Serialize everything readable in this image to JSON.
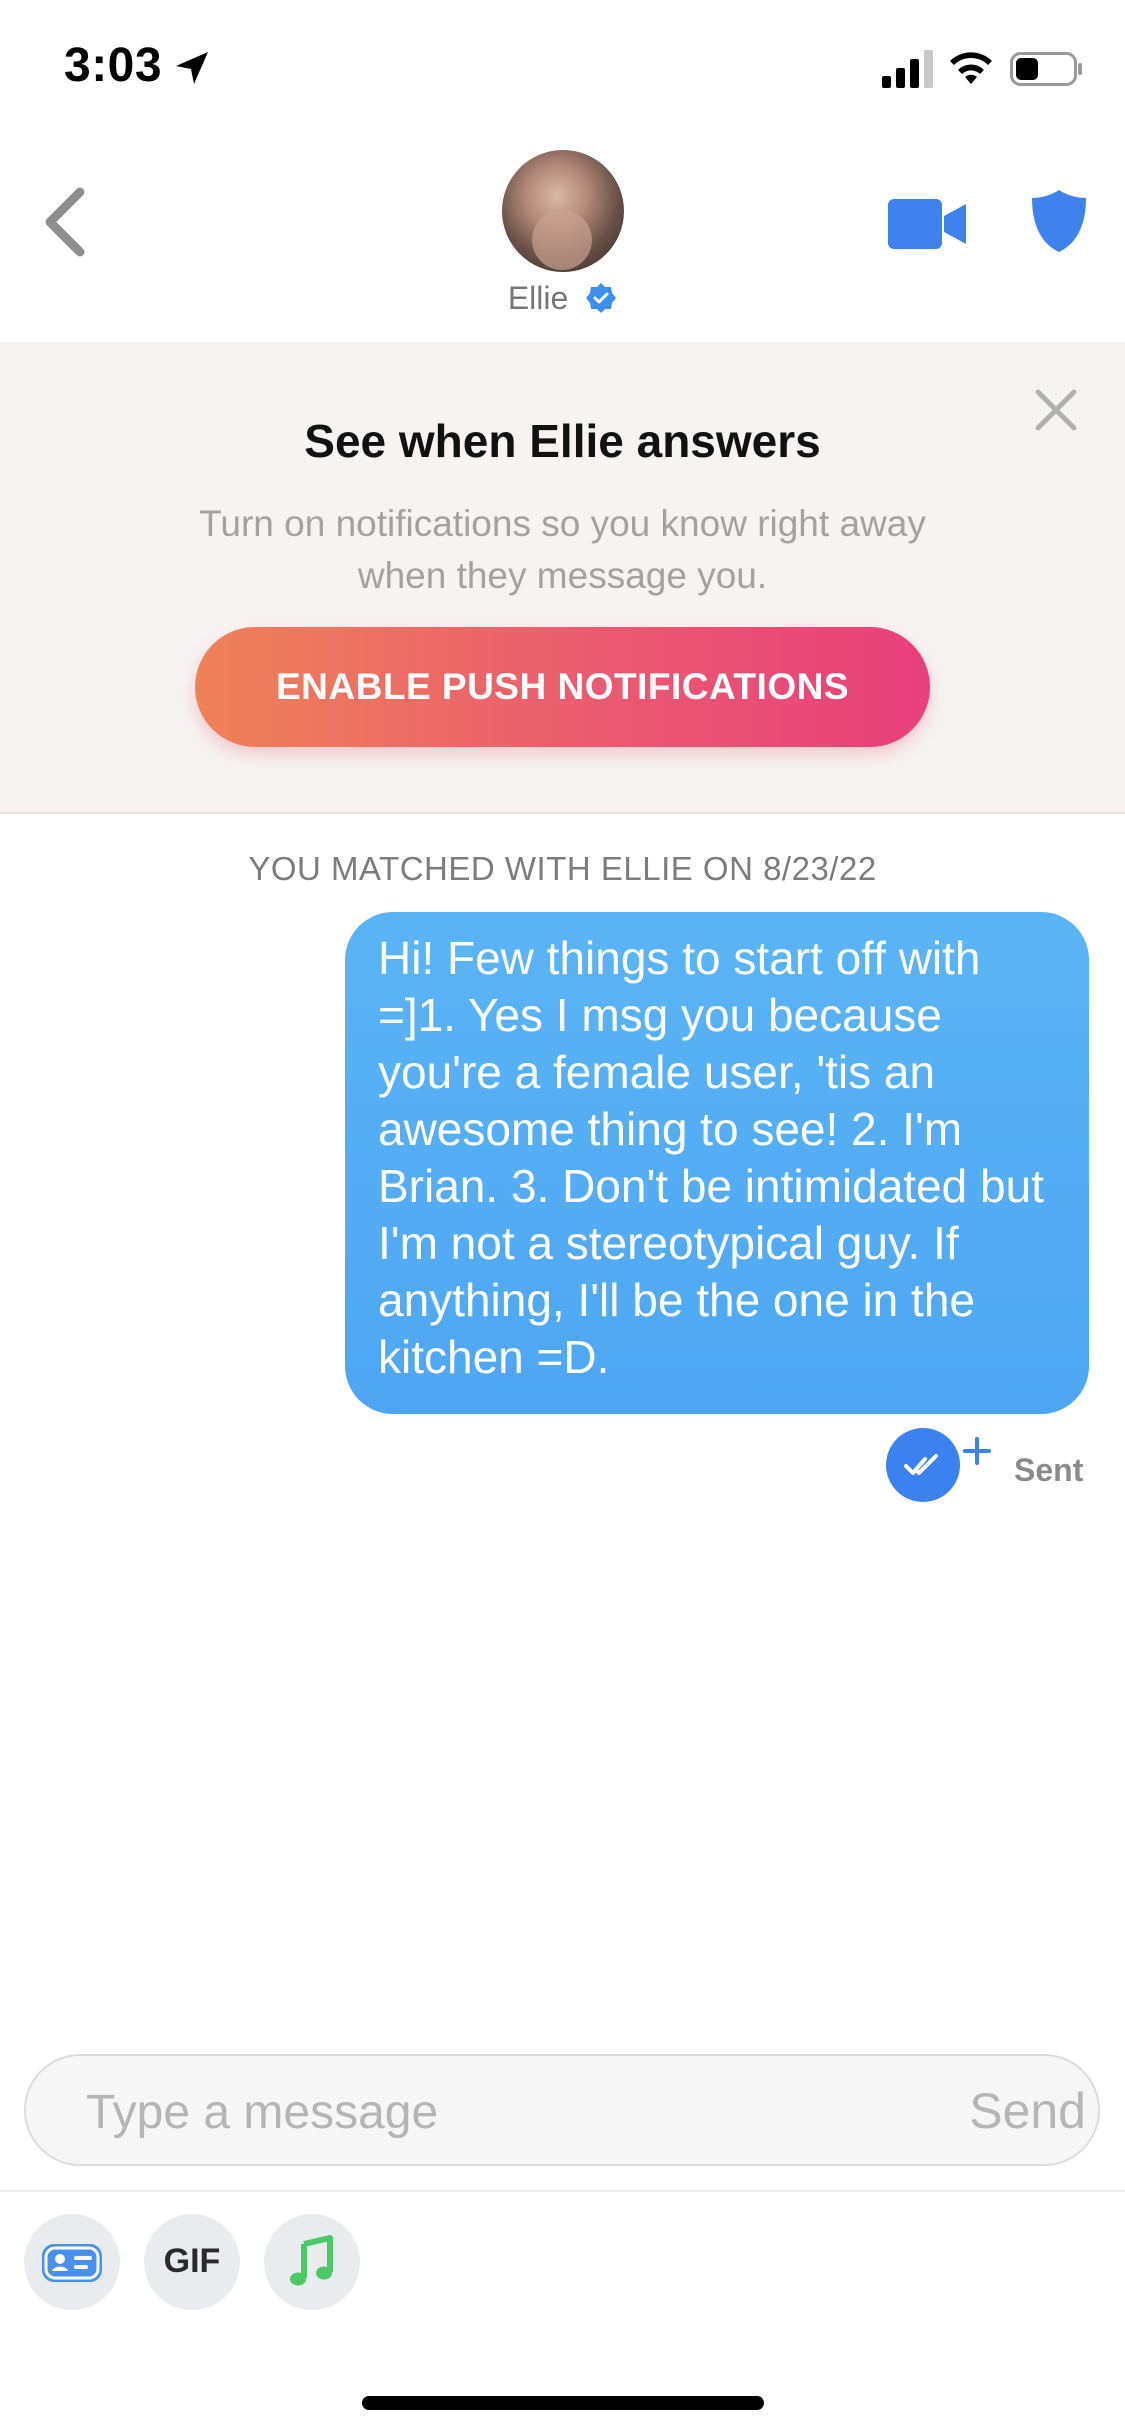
{
  "status_bar": {
    "time": "3:03"
  },
  "header": {
    "name": "Ellie"
  },
  "banner": {
    "title": "See when Ellie answers",
    "subtitle": "Turn on notifications so you know right away when they message you.",
    "button_label": "ENABLE PUSH NOTIFICATIONS"
  },
  "chat": {
    "match_text": "YOU MATCHED WITH ELLIE ON 8/23/22",
    "messages": [
      {
        "text": "Hi! Few things to start off with =]1. Yes I msg you because you're a female user, 'tis an awesome thing to see! 2. I'm Brian. 3. Don't be intimidated but I'm not a stereotypical guy. If anything, I'll be the one in the kitchen =D.",
        "status": "Sent"
      }
    ]
  },
  "composer": {
    "placeholder": "Type a message",
    "send_label": "Send",
    "gif_label": "GIF"
  },
  "colors": {
    "accent_blue": "#3c81f0",
    "bubble_blue": "#52abf4",
    "gradient_start": "#ef8258",
    "gradient_end": "#e83f7c"
  },
  "icons": [
    "location-arrow-icon",
    "signal-icon",
    "wifi-icon",
    "battery-icon",
    "chevron-left-icon",
    "verified-badge-icon",
    "video-camera-icon",
    "shield-icon",
    "close-icon",
    "double-check-icon",
    "plus-icon",
    "profile-card-icon",
    "music-note-icon"
  ]
}
